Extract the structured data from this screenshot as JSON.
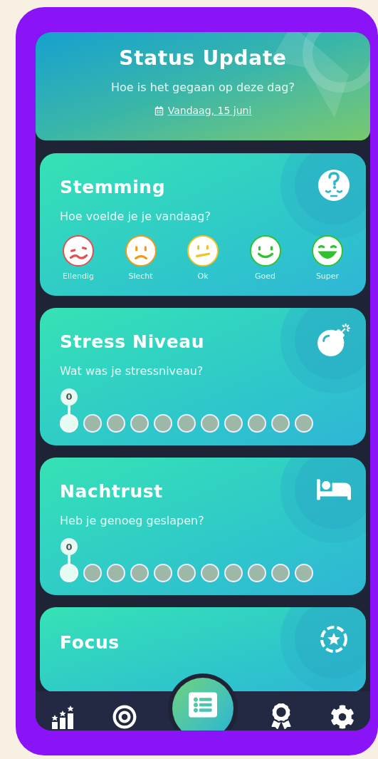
{
  "header": {
    "title": "Status Update",
    "subtitle": "Hoe is het gegaan op deze dag?",
    "date_link": "Vandaag, 15 juni"
  },
  "cards": [
    {
      "kind": "mood",
      "title": "Stemming",
      "question": "Hoe voelde je je vandaag?",
      "moods": [
        {
          "label": "Ellendig",
          "color": "#e0504f",
          "selected": false
        },
        {
          "label": "Slecht",
          "color": "#f09a1a",
          "selected": false
        },
        {
          "label": "Ok",
          "color": "#f2c21e",
          "selected": false
        },
        {
          "label": "Goed",
          "color": "#2fc22f",
          "selected": false
        },
        {
          "label": "Super",
          "color": "#2fc22f",
          "selected": false
        }
      ]
    },
    {
      "kind": "scale",
      "title": "Stress Niveau",
      "question": "Wat was je stressniveau?",
      "value": "0",
      "dots": [
        {
          "selected": true
        },
        {
          "selected": false
        },
        {
          "selected": false
        },
        {
          "selected": false
        },
        {
          "selected": false
        },
        {
          "selected": false
        },
        {
          "selected": false
        },
        {
          "selected": false
        },
        {
          "selected": false
        },
        {
          "selected": false
        },
        {
          "selected": false
        }
      ]
    },
    {
      "kind": "scale",
      "title": "Nachtrust",
      "question": "Heb je genoeg geslapen?",
      "value": "0",
      "dots": [
        {
          "selected": true
        },
        {
          "selected": false
        },
        {
          "selected": false
        },
        {
          "selected": false
        },
        {
          "selected": false
        },
        {
          "selected": false
        },
        {
          "selected": false
        },
        {
          "selected": false
        },
        {
          "selected": false
        },
        {
          "selected": false
        },
        {
          "selected": false
        }
      ]
    },
    {
      "kind": "partial",
      "title": "Focus"
    }
  ],
  "nav": [
    {
      "selected": false
    },
    {
      "selected": false
    },
    {
      "selected": true
    },
    {
      "selected": false
    },
    {
      "selected": false
    }
  ]
}
